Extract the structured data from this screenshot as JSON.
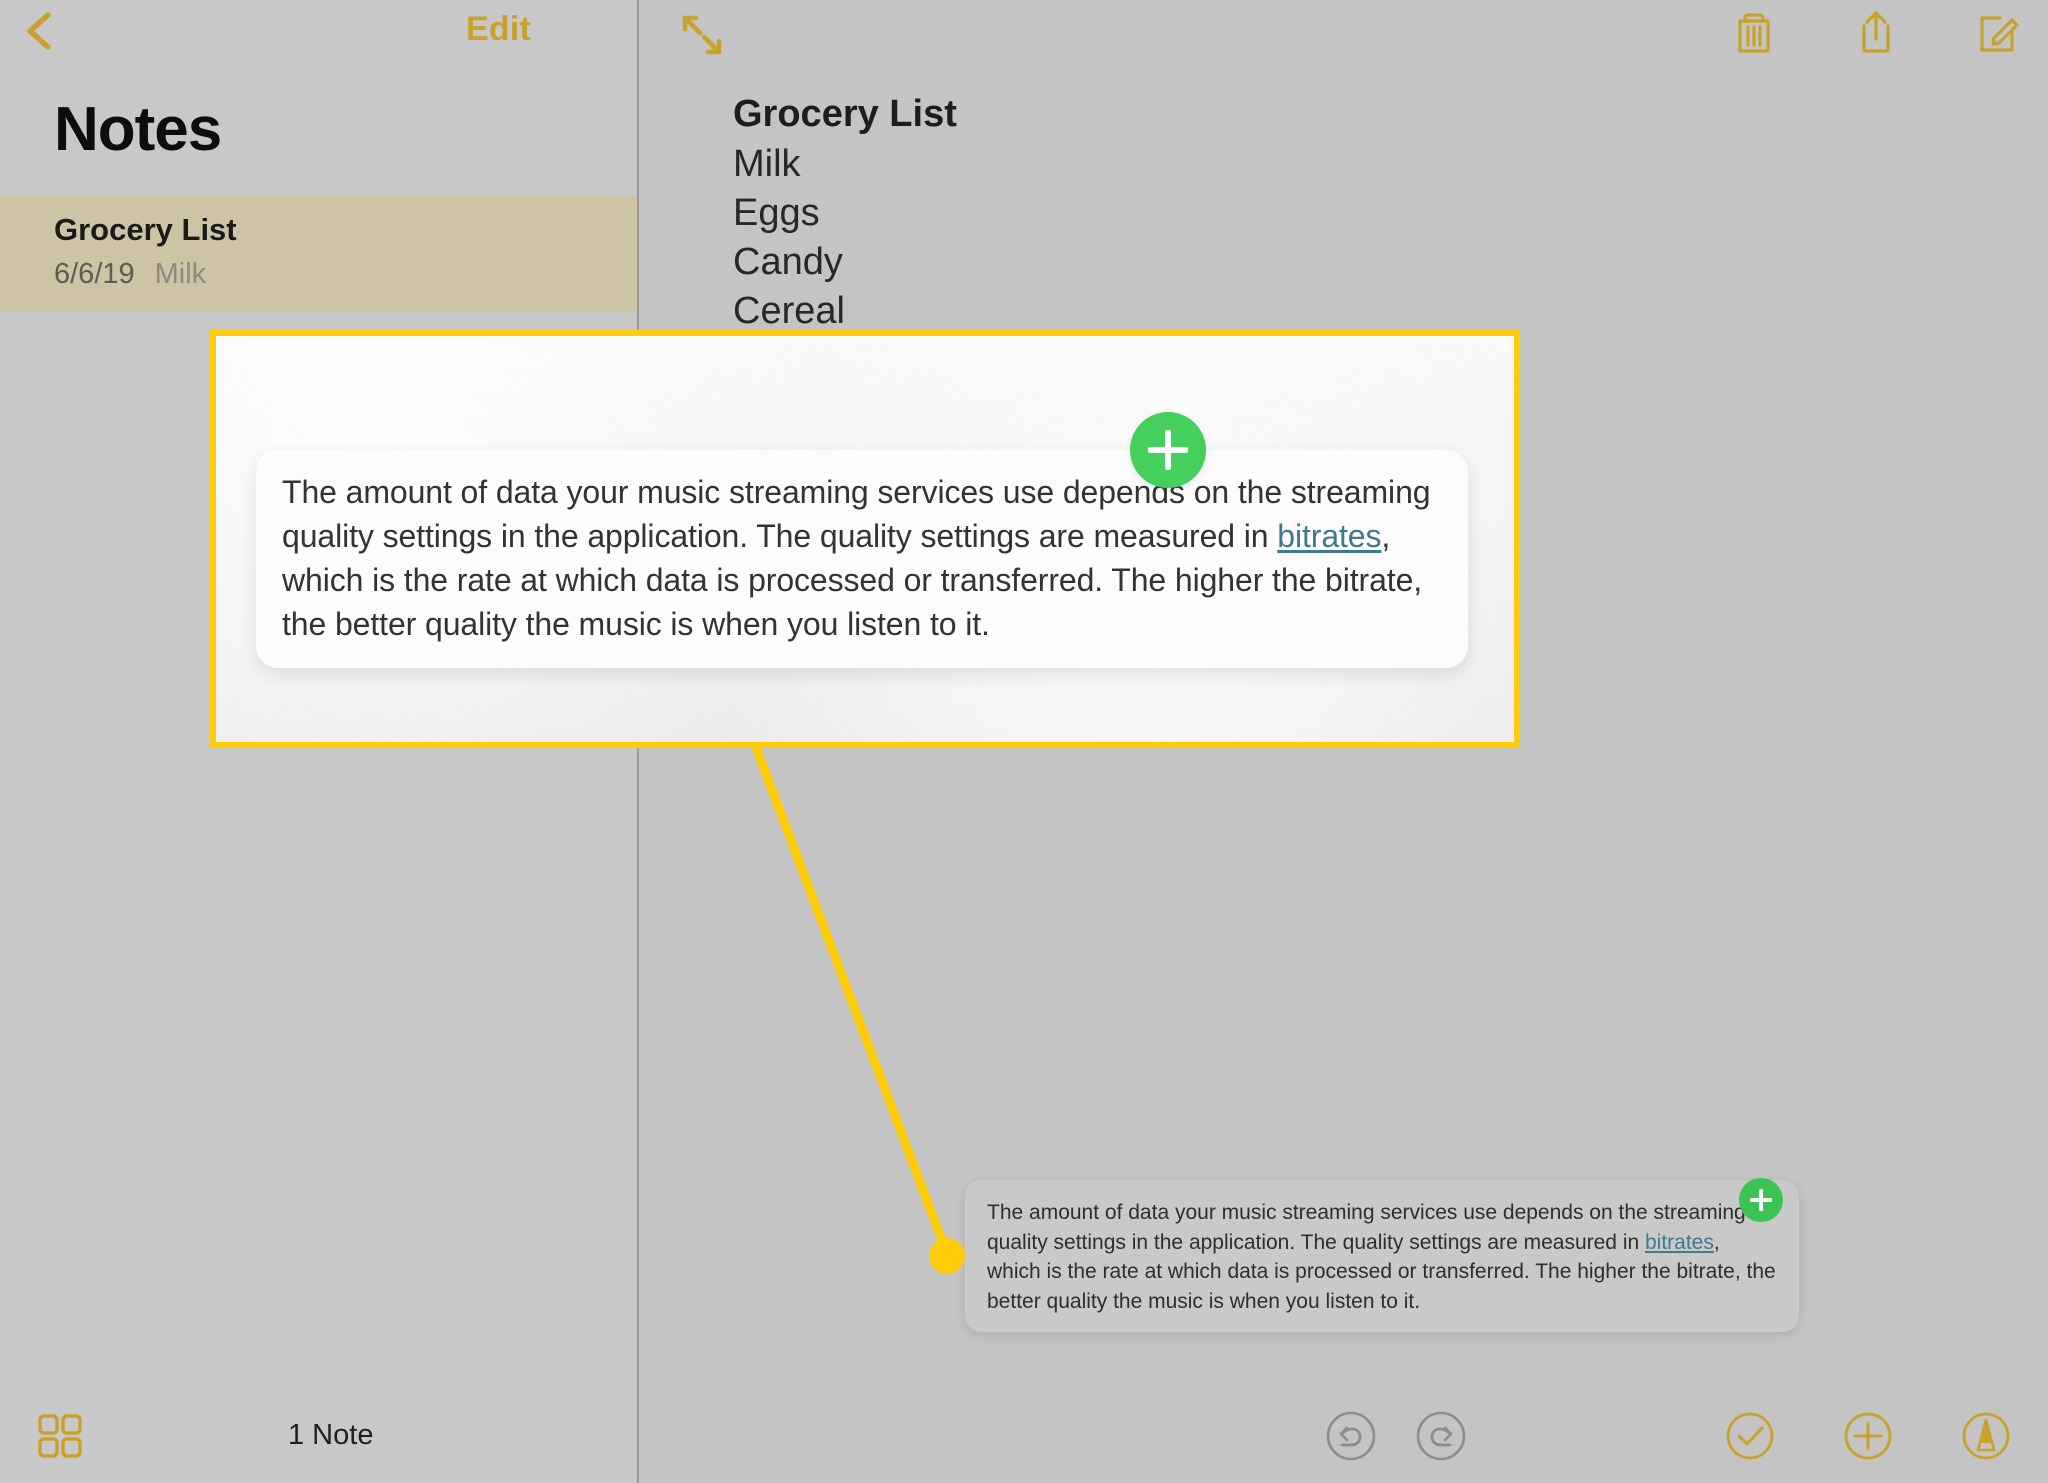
{
  "app": {
    "name": "Notes",
    "title": "Notes"
  },
  "sidebar": {
    "back_icon": "back-chevron-icon",
    "edit_label": "Edit",
    "title": "Notes",
    "notes": [
      {
        "title": "Grocery List",
        "date": "6/6/19",
        "preview": "Milk",
        "selected": true
      }
    ],
    "footer": {
      "gallery_icon": "grid-gallery-icon",
      "count_label": "1 Note"
    }
  },
  "detail": {
    "expand_icon": "expand-arrows-icon",
    "toolbar": [
      {
        "name": "delete-note-button",
        "icon": "trash-icon"
      },
      {
        "name": "share-note-button",
        "icon": "share-upload-icon"
      },
      {
        "name": "compose-note-button",
        "icon": "compose-pencil-icon"
      }
    ],
    "note": {
      "title": "Grocery List",
      "items": [
        "Milk",
        "Eggs",
        "Candy",
        "Cereal"
      ]
    },
    "bottom_toolbar": [
      {
        "name": "undo-button",
        "icon": "undo-circle-icon"
      },
      {
        "name": "redo-button",
        "icon": "redo-circle-icon"
      },
      {
        "name": "checklist-button",
        "icon": "check-circle-icon"
      },
      {
        "name": "add-attachment-button",
        "icon": "plus-circle-icon"
      },
      {
        "name": "markup-button",
        "icon": "markup-pen-circle-icon"
      }
    ]
  },
  "annotation": {
    "highlight_color": "#ffcc0a",
    "accent_gold": "#c8a22a",
    "green_accent": "#3bc453",
    "link_color": "#3d7a8c",
    "tooltip": {
      "text_before_link": "The amount of data your music streaming services use depends on the streaming quality settings in the application. The quality settings are measured in ",
      "link_text": "bitrates",
      "text_after_link": ", which is the rate at which data is processed or transferred. The higher the bitrate, the better quality the music is when you listen to it.",
      "add_button_icon": "plus-circle-green-icon"
    }
  }
}
